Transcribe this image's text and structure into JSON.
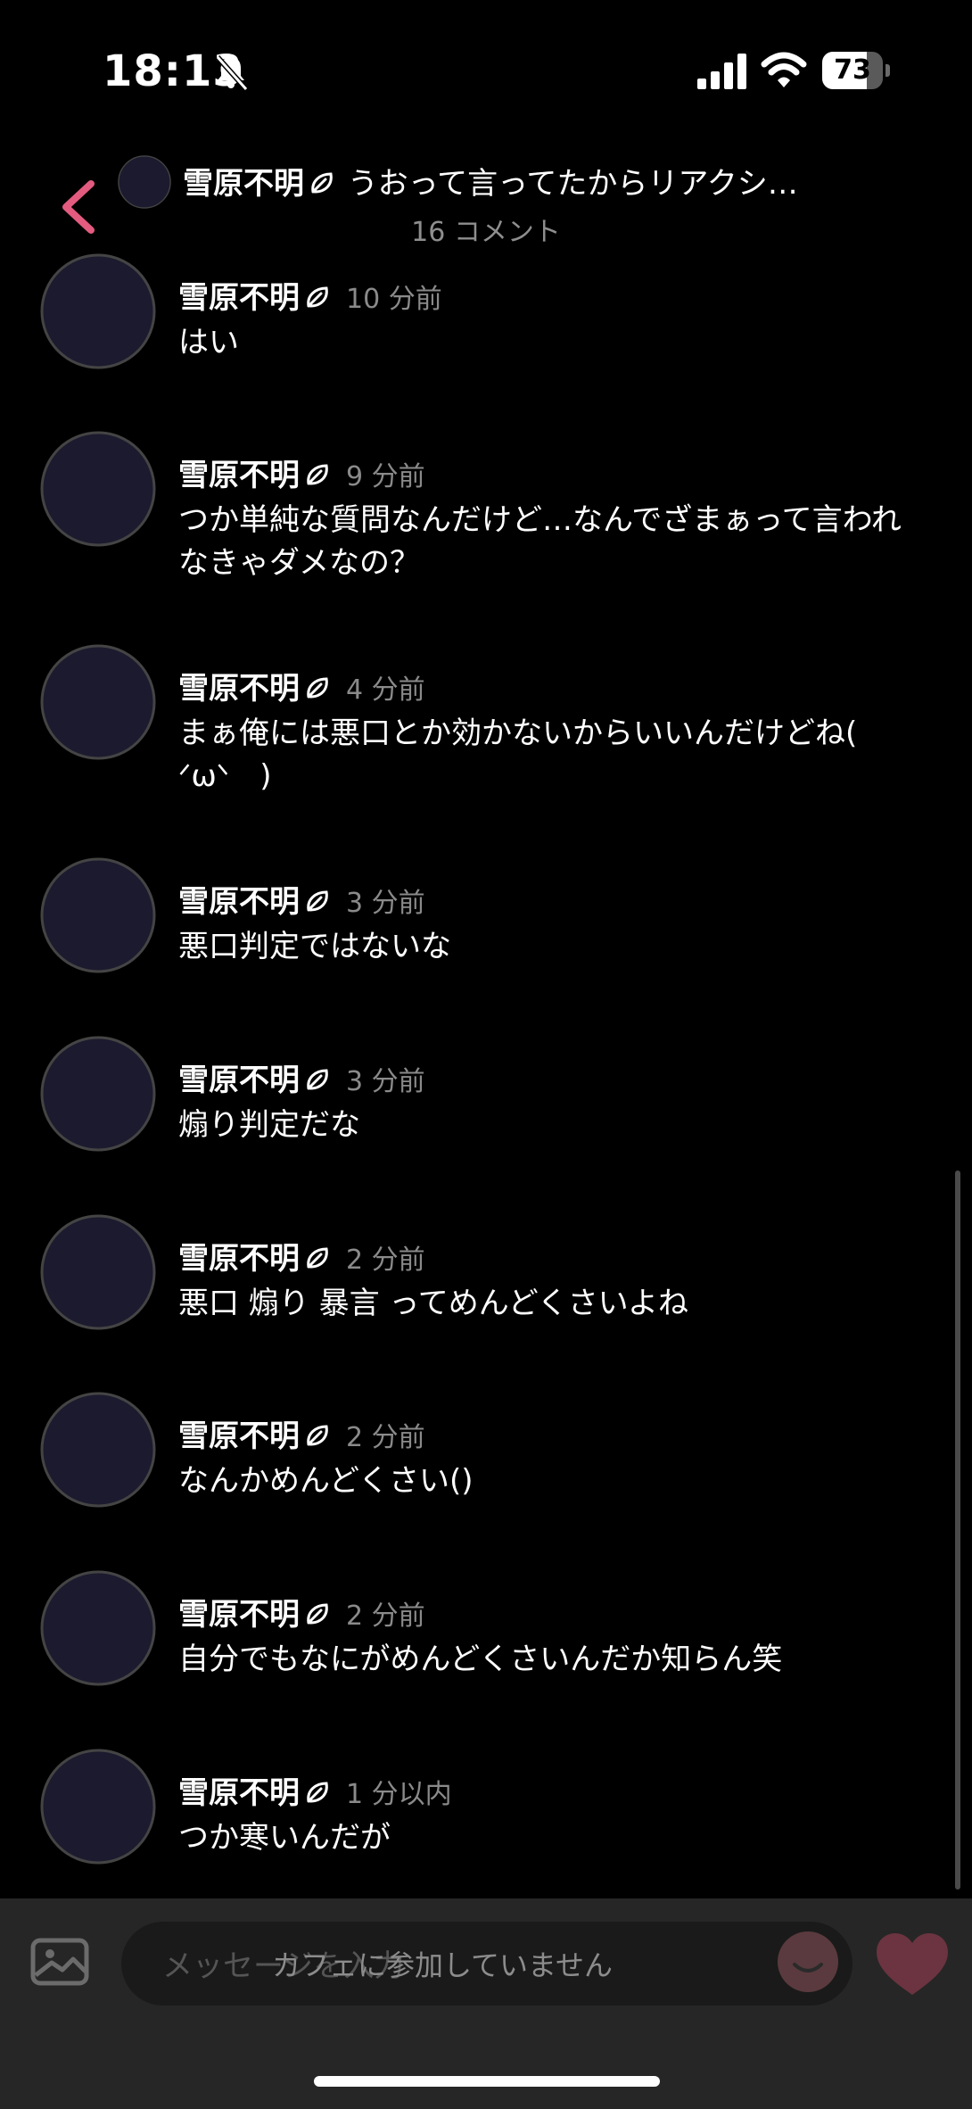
{
  "status_bar": {
    "time": "18:13",
    "battery": "73",
    "battery_level": 0.73
  },
  "header": {
    "author": "雪原不明",
    "title": "うおって言ってたからリアクシ…",
    "comment_count": "16 コメント"
  },
  "comments": [
    {
      "name": "雪原不明",
      "time": "10 分前",
      "text": "はい"
    },
    {
      "name": "雪原不明",
      "time": "9 分前",
      "text": "つか単純な質問なんだけど…なんでざまぁって言われなきゃダメなの？"
    },
    {
      "name": "雪原不明",
      "time": "4 分前",
      "text": "まぁ俺には悪口とか効かないからいいんだけどね(　ᐟωᐠ　)"
    },
    {
      "name": "雪原不明",
      "time": "3 分前",
      "text": "悪口判定ではないな"
    },
    {
      "name": "雪原不明",
      "time": "3 分前",
      "text": "煽り判定だな"
    },
    {
      "name": "雪原不明",
      "time": "2 分前",
      "text": "悪口 煽り 暴言 ってめんどくさいよね"
    },
    {
      "name": "雪原不明",
      "time": "2 分前",
      "text": "なんかめんどくさい()"
    },
    {
      "name": "雪原不明",
      "time": "2 分前",
      "text": "自分でもなにがめんどくさいんだか知らん笑"
    },
    {
      "name": "雪原不明",
      "time": "1 分以内",
      "text": "つか寒いんだが"
    }
  ],
  "composer": {
    "placeholder": "メッセージを入力",
    "notice": "カフェに参加していません"
  },
  "icons": {
    "back": "chevron-left-icon",
    "badge": "leaf-badge-icon",
    "image": "image-icon",
    "sticker": "smiley-icon",
    "heart": "heart-icon"
  },
  "colors": {
    "accent": "#e35b7f",
    "background": "#000000",
    "composer": "#262626"
  }
}
